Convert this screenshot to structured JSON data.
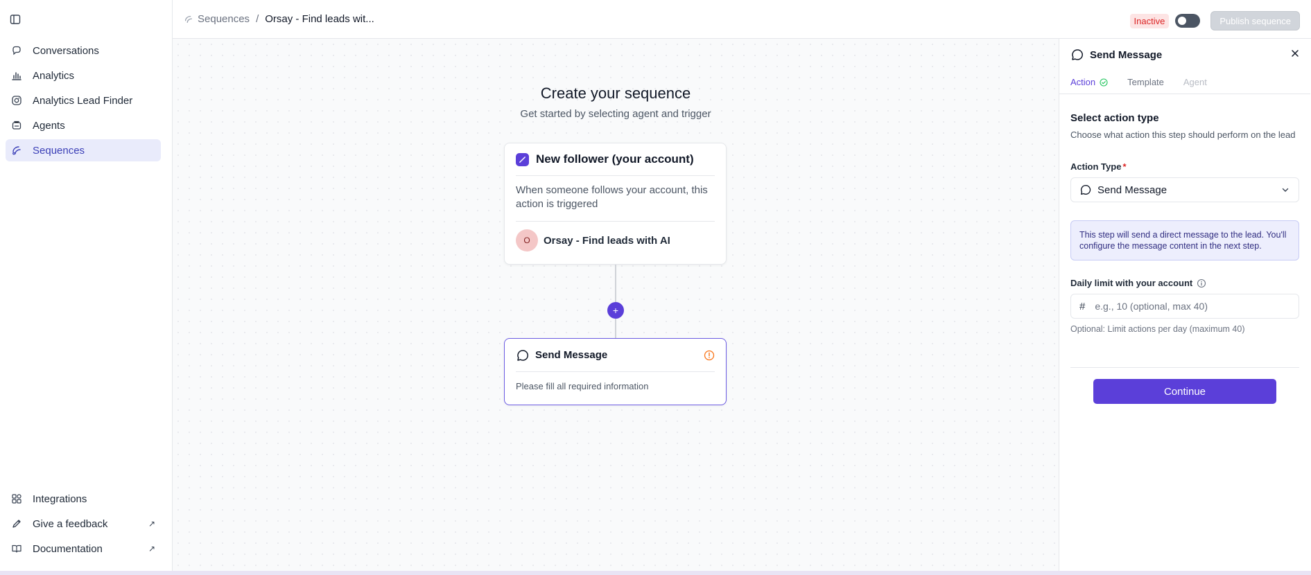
{
  "sidebar": {
    "toggle_icon": "panel-left-icon",
    "items": [
      {
        "label": "Conversations",
        "icon": "chat-icon"
      },
      {
        "label": "Analytics",
        "icon": "bar-chart-icon"
      },
      {
        "label": "Analytics Lead Finder",
        "icon": "instagram-icon"
      },
      {
        "label": "Agents",
        "icon": "bot-icon"
      },
      {
        "label": "Sequences",
        "icon": "sequence-icon",
        "active": true
      }
    ],
    "bottom": [
      {
        "label": "Integrations",
        "icon": "grid-icon"
      },
      {
        "label": "Give a feedback",
        "icon": "feedback-icon",
        "external": true
      },
      {
        "label": "Documentation",
        "icon": "book-icon",
        "external": true
      }
    ],
    "external_glyph": "↗"
  },
  "header": {
    "breadcrumb_root": "Sequences",
    "breadcrumb_sep": "/",
    "breadcrumb_current": "Orsay - Find leads wit...",
    "status_badge": "Inactive",
    "publish_label": "Publish sequence"
  },
  "canvas": {
    "title": "Create your sequence",
    "subtitle": "Get started by selecting agent and trigger",
    "trigger": {
      "title": "New follower (your account)",
      "description": "When someone follows your account, this action is triggered",
      "agent_initial": "O",
      "agent_name": "Orsay - Find leads with AI"
    },
    "add_glyph": "+",
    "step": {
      "title": "Send Message",
      "description": "Please fill all required information"
    }
  },
  "panel": {
    "title": "Send Message",
    "tabs": [
      {
        "label": "Action",
        "state": "active",
        "complete": true
      },
      {
        "label": "Template",
        "state": "muted"
      },
      {
        "label": "Agent",
        "state": "disabled"
      }
    ],
    "section_title": "Select action type",
    "section_subtitle": "Choose what action this step should perform on the lead",
    "action_type_label": "Action Type",
    "required_mark": "*",
    "action_type_value": "Send Message",
    "info_text": "This step will send a direct message to the lead. You'll configure the message content in the next step.",
    "limit_label": "Daily limit with your account",
    "limit_hash": "#",
    "limit_placeholder": "e.g., 10 (optional, max 40)",
    "limit_value": "",
    "limit_hint": "Optional: Limit actions per day (maximum 40)",
    "continue_label": "Continue"
  },
  "colors": {
    "accent": "#5b3fd9",
    "active_nav_bg": "#e9ebfb",
    "inactive_badge_bg": "#fde4e4",
    "inactive_badge_text": "#dc2626",
    "warning": "#f97316",
    "success": "#22c55e"
  }
}
